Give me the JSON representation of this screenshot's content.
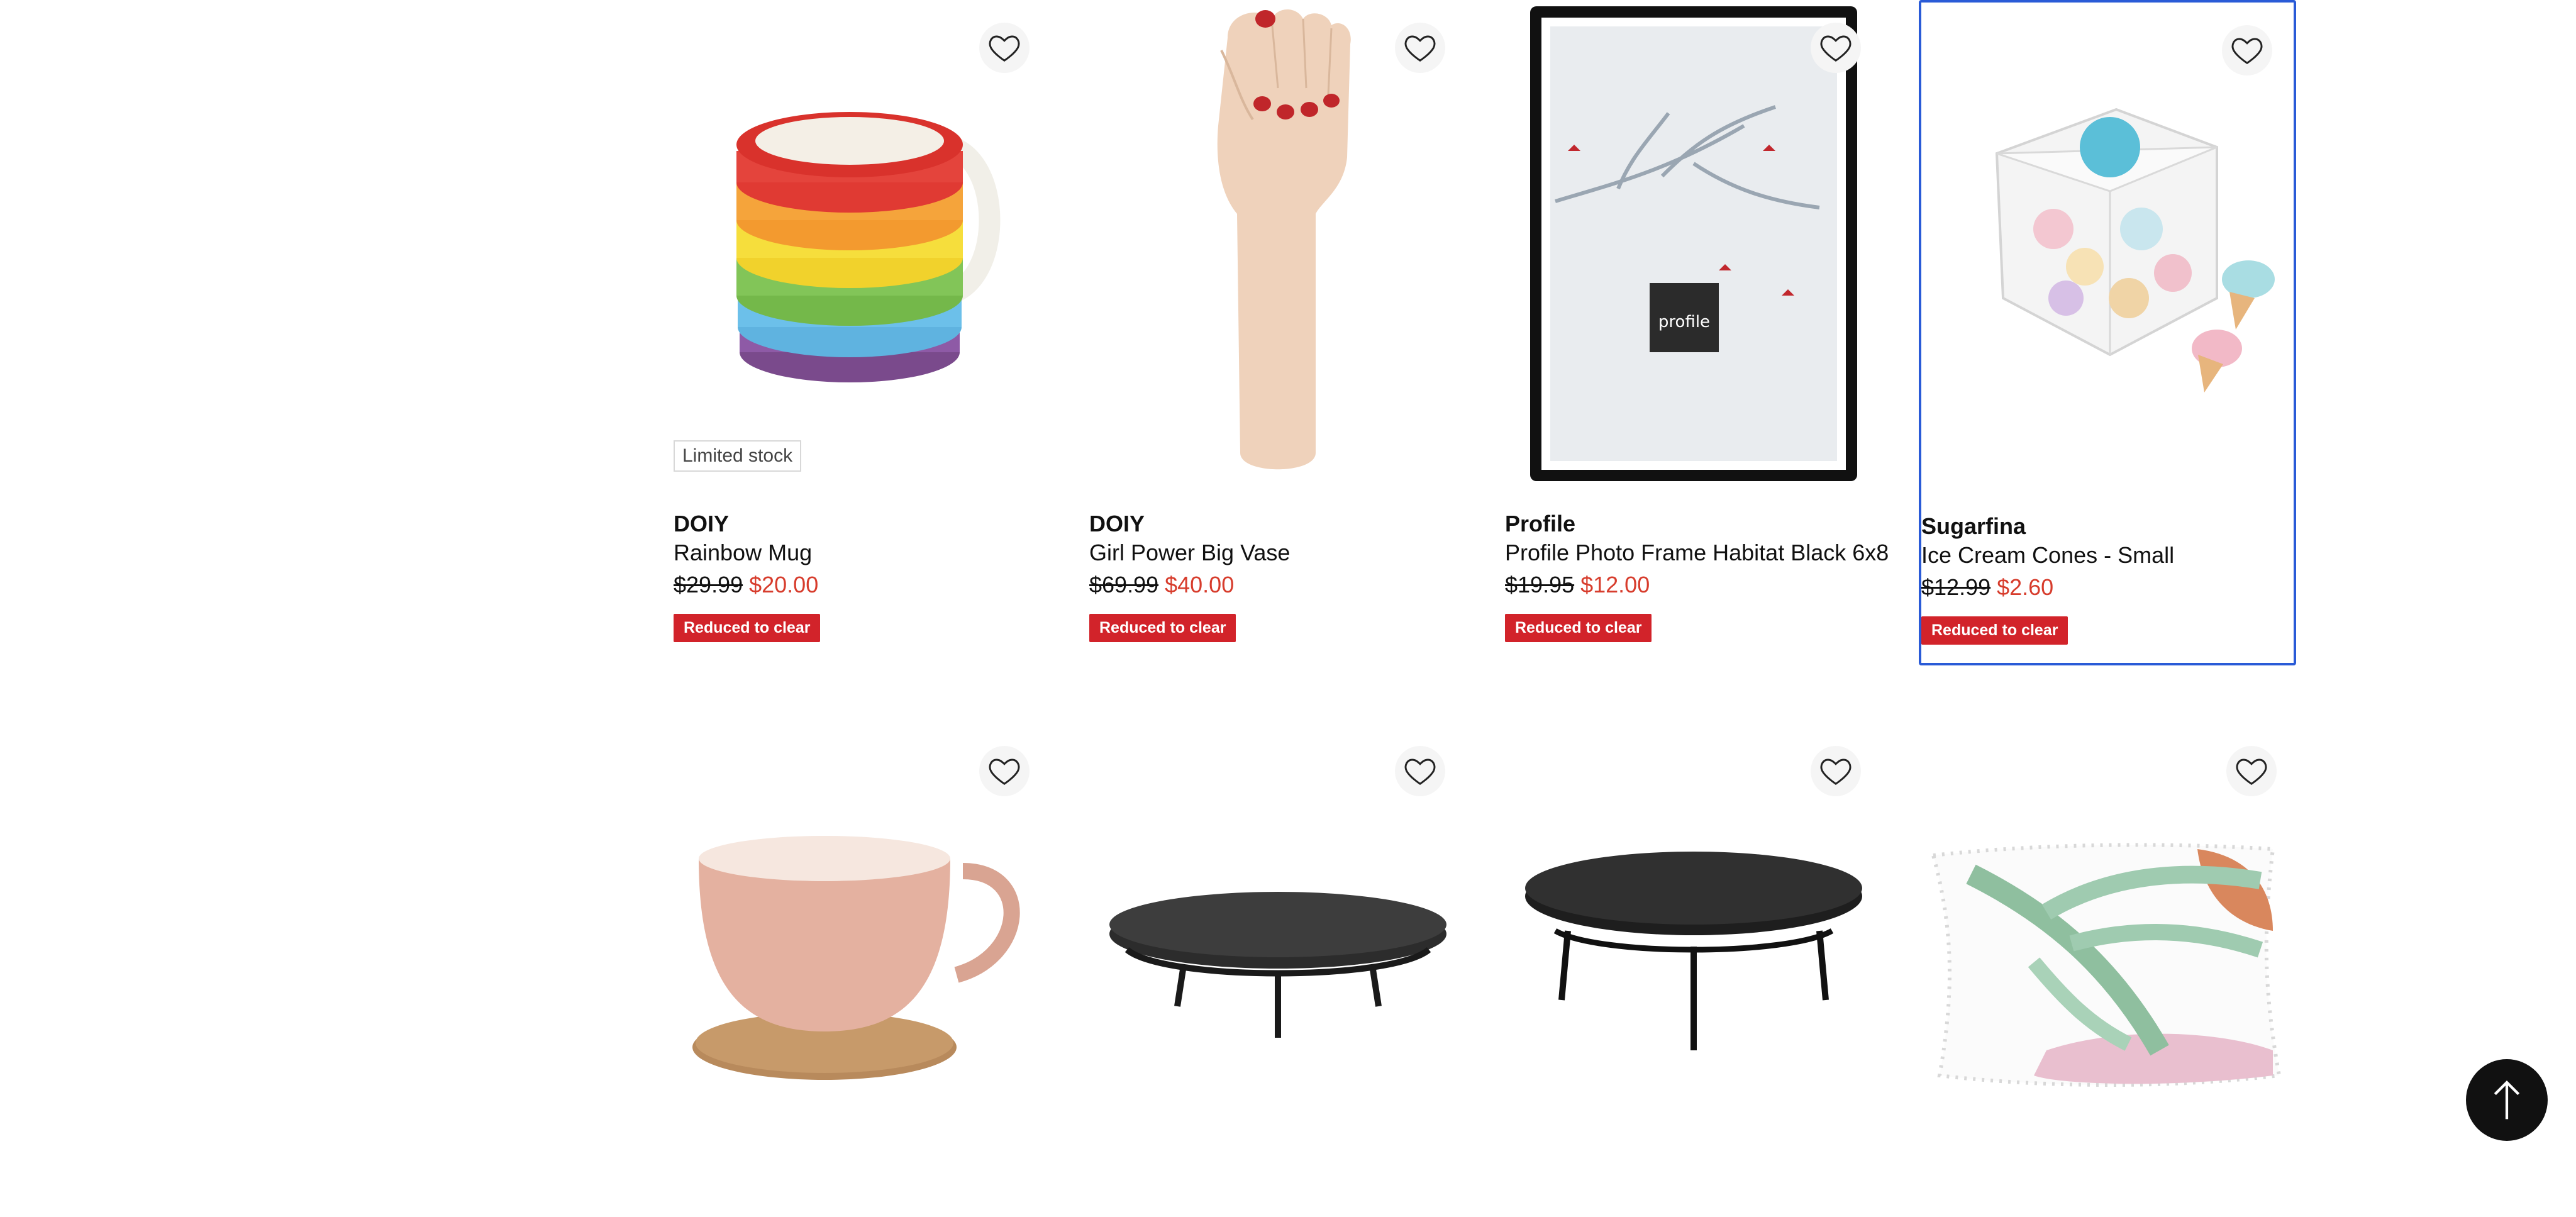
{
  "products": [
    {
      "brand": "DOIY",
      "name": "Rainbow Mug",
      "was_price": "$29.99",
      "now_price": "$20.00",
      "badge": "Reduced to clear",
      "stock": "Limited stock",
      "image": "rainbow-mug"
    },
    {
      "brand": "DOIY",
      "name": "Girl Power Big Vase",
      "was_price": "$69.99",
      "now_price": "$40.00",
      "badge": "Reduced to clear",
      "stock": "",
      "image": "hand-vase"
    },
    {
      "brand": "Profile",
      "name": "Profile Photo Frame Habitat Black 6x8",
      "was_price": "$19.95",
      "now_price": "$12.00",
      "badge": "Reduced to clear",
      "stock": "",
      "image": "photo-frame"
    },
    {
      "brand": "Sugarfina",
      "name": "Ice Cream Cones - Small",
      "was_price": "$12.99",
      "now_price": "$2.60",
      "badge": "Reduced to clear",
      "stock": "",
      "image": "candy-cube"
    },
    {
      "image": "pink-cup"
    },
    {
      "image": "marble-stand"
    },
    {
      "image": "black-stand"
    },
    {
      "image": "leaf-cushion"
    }
  ],
  "icons": {
    "wishlist": "heart-outline-icon",
    "back_to_top": "arrow-up-icon"
  },
  "colors": {
    "sale_badge": "#d2232a",
    "sale_price": "#d73c2c",
    "focus_border": "#2a5bd7"
  }
}
